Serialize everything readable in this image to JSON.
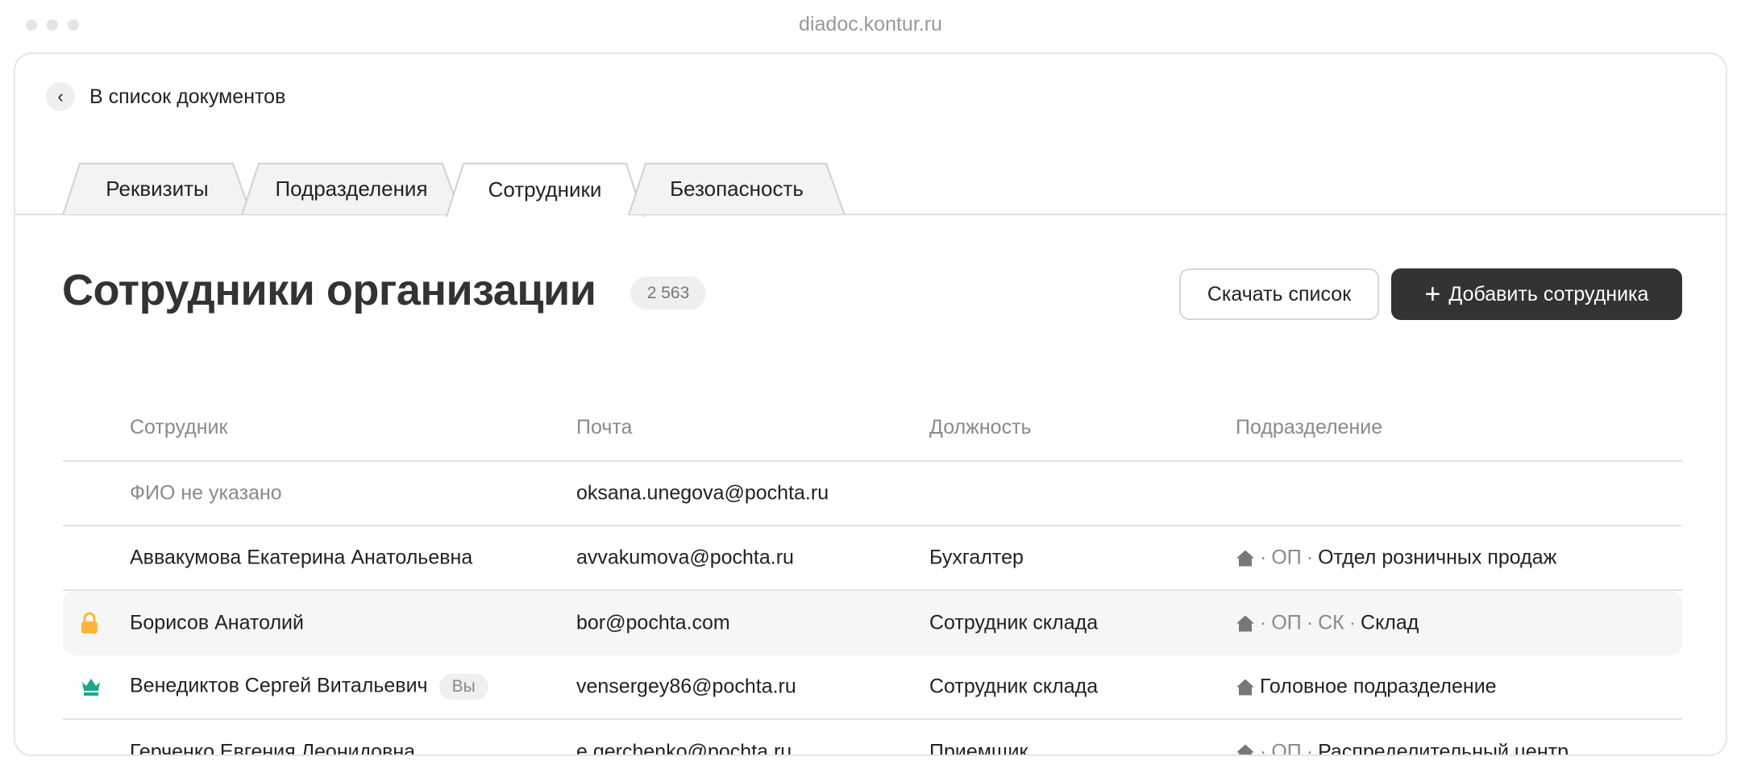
{
  "browser": {
    "url": "diadoc.kontur.ru"
  },
  "back_link": {
    "label": "В список документов"
  },
  "tabs": [
    {
      "label": "Реквизиты"
    },
    {
      "label": "Подразделения"
    },
    {
      "label": "Сотрудники",
      "active": true
    },
    {
      "label": "Безопасность"
    }
  ],
  "page": {
    "title": "Сотрудники организации",
    "count": "2 563"
  },
  "actions": {
    "download": "Скачать список",
    "add": "Добавить сотрудника"
  },
  "table": {
    "columns": [
      "Сотрудник",
      "Почта",
      "Должность",
      "Подразделение"
    ],
    "rows": [
      {
        "name": "ФИО не указано",
        "email": "oksana.unegova@pochta.ru",
        "position": "",
        "path": [],
        "unit": ""
      },
      {
        "name": "Аввакумова Екатерина Анатольевна",
        "email": "avvakumova@pochta.ru",
        "position": "Бухгалтер",
        "path": [
          "ОП"
        ],
        "unit": "Отдел розничных продаж"
      },
      {
        "name": "Борисов Анатолий",
        "email": "bor@pochta.com",
        "position": "Сотрудник склада",
        "path": [
          "ОП",
          "СК"
        ],
        "unit": "Склад",
        "icon": "lock-icon"
      },
      {
        "name": "Венедиктов Сергей Витальевич",
        "badge": "Вы",
        "email": "vensergey86@pochta.ru",
        "position": "Сотрудник склада",
        "path": [],
        "unit": "Головное подразделение",
        "icon": "crown-icon"
      },
      {
        "name": "Герченко Евгения Леонидовна",
        "email": "e.gerchenko@pochta.ru",
        "position": "Приемщик",
        "path": [
          "ОП"
        ],
        "unit": "Распределительный центр"
      }
    ]
  },
  "colors": {
    "lock": "#FDB53C",
    "crown": "#1AA68F",
    "dark_button": "#333333"
  }
}
